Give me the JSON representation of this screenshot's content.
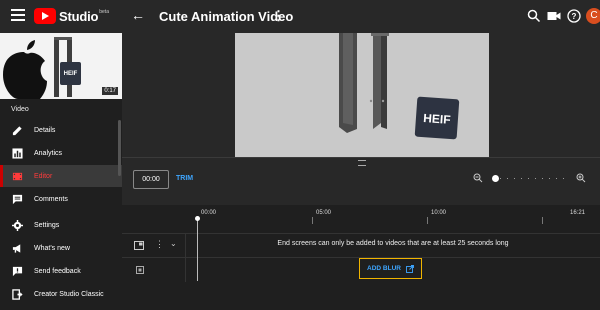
{
  "app": {
    "name": "Studio",
    "beta": "beta"
  },
  "header": {
    "title": "Cute Animation Video",
    "avatar_letter": "C"
  },
  "sidebar": {
    "thumbnail": {
      "duration": "0:17",
      "overlay_text": "HEIF"
    },
    "section_label": "Video",
    "items": [
      {
        "label": "Details",
        "icon": "pencil-icon",
        "active": false
      },
      {
        "label": "Analytics",
        "icon": "bar-chart-icon",
        "active": false
      },
      {
        "label": "Editor",
        "icon": "film-icon",
        "active": true
      },
      {
        "label": "Comments",
        "icon": "comment-icon",
        "active": false
      },
      {
        "label": "Settings",
        "icon": "gear-icon",
        "active": false
      },
      {
        "label": "What's new",
        "icon": "megaphone-icon",
        "active": false
      },
      {
        "label": "Send feedback",
        "icon": "feedback-icon",
        "active": false
      },
      {
        "label": "Creator Studio Classic",
        "icon": "exit-icon",
        "active": false
      }
    ]
  },
  "player": {
    "overlay_text": "HEIF"
  },
  "editor": {
    "time_value": "00:00",
    "trim_label": "TRIM",
    "zoom_level": 0.05,
    "ruler": [
      "00:00",
      "05:00",
      "10:00",
      "16:21"
    ],
    "end_screen_message": "End screens can only be added to videos that are at least 25 seconds long",
    "add_blur_label": "ADD BLUR"
  },
  "colors": {
    "accent": "#3ea6ff",
    "brand": "#ff0000",
    "highlight": "#f0b400",
    "avatar": "#d94e1f"
  }
}
